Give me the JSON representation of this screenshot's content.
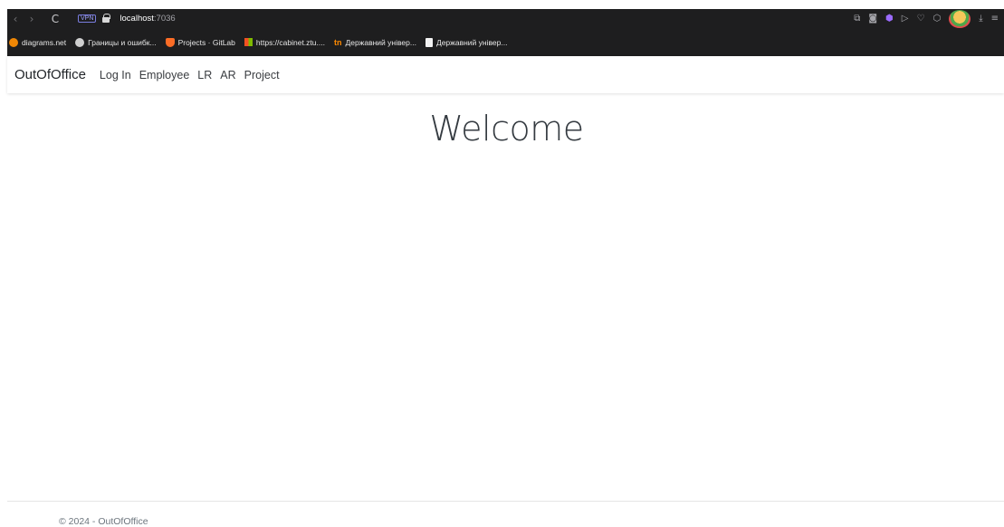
{
  "browser": {
    "url_host": "localhost",
    "url_port": ":7036",
    "vpn_label": "VPN",
    "nav_back": "‹",
    "nav_forward": "›",
    "nav_reload": "C",
    "toolbar_icons": [
      "share-icon",
      "camera-icon",
      "shield-icon",
      "play-icon",
      "heart-icon",
      "cube-icon",
      "avatar-icon",
      "download-icon",
      "menu-icon"
    ],
    "bookmarks": [
      {
        "label": "diagrams.net",
        "icon": "drawio-icon"
      },
      {
        "label": "Границы и ошибк...",
        "icon": "globe-icon"
      },
      {
        "label": "Projects · GitLab",
        "icon": "gitlab-icon"
      },
      {
        "label": "https://cabinet.ztu....",
        "icon": "ms-icon"
      },
      {
        "label": "Державний універ...",
        "icon": "tn-icon"
      },
      {
        "label": "Державний універ...",
        "icon": "doc-icon"
      }
    ]
  },
  "navbar": {
    "brand": "OutOfOffice",
    "links": [
      "Log In",
      "Employee",
      "LR",
      "AR",
      "Project"
    ]
  },
  "main": {
    "heading": "Welcome"
  },
  "footer": {
    "text": "© 2024 - OutOfOffice"
  },
  "colors": {
    "browser_bg": "#1e1e1f",
    "text_dark": "#212529",
    "footer_text": "#6c757d"
  }
}
